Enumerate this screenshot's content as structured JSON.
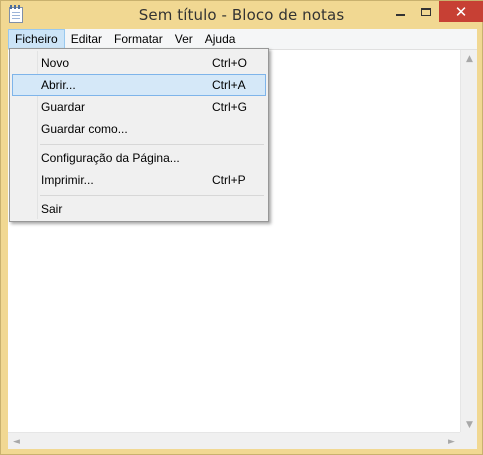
{
  "window": {
    "title": "Sem título - Bloco de notas",
    "controls": {
      "minimize": "",
      "maximize": "",
      "close": "✕"
    }
  },
  "menubar": {
    "items": [
      {
        "label": "Ficheiro"
      },
      {
        "label": "Editar"
      },
      {
        "label": "Formatar"
      },
      {
        "label": "Ver"
      },
      {
        "label": "Ajuda"
      }
    ],
    "active": "Ficheiro"
  },
  "dropdown": {
    "items": [
      {
        "label": "Novo",
        "shortcut": "Ctrl+O"
      },
      {
        "label": "Abrir...",
        "shortcut": "Ctrl+A",
        "highlighted": true
      },
      {
        "label": "Guardar",
        "shortcut": "Ctrl+G"
      },
      {
        "label": "Guardar como...",
        "shortcut": ""
      },
      {
        "label": "Configuração da Página...",
        "shortcut": ""
      },
      {
        "label": "Imprimir...",
        "shortcut": "Ctrl+P"
      },
      {
        "label": "Sair",
        "shortcut": ""
      }
    ]
  },
  "editor": {
    "content": ""
  },
  "scroll": {
    "up": "▲",
    "down": "▼",
    "left": "◄",
    "right": "►"
  }
}
